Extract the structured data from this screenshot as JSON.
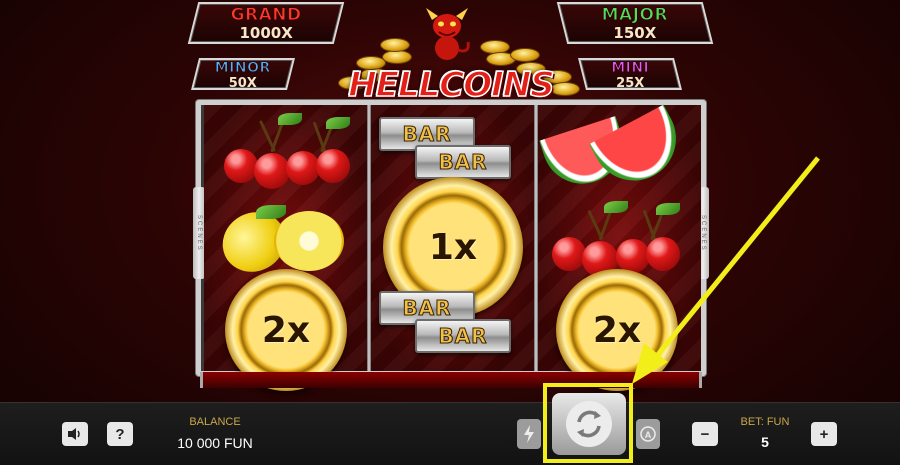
{
  "jackpots": {
    "grand": {
      "name": "GRAND",
      "multiplier": "1000X"
    },
    "major": {
      "name": "MAJOR",
      "multiplier": "150X"
    },
    "minor": {
      "name": "MINOR",
      "multiplier": "50X"
    },
    "mini": {
      "name": "MINI",
      "multiplier": "25X"
    }
  },
  "logo": "HELLCOINS",
  "reels": [
    {
      "symbols": [
        "cherries",
        "lemons",
        "coin"
      ],
      "coin_value": "2x"
    },
    {
      "symbols": [
        "bar-bar",
        "coin",
        "bar-bar"
      ],
      "coin_value": "1x",
      "bar_label": "BAR"
    },
    {
      "symbols": [
        "watermelon",
        "cherries",
        "coin"
      ],
      "coin_value": "2x"
    }
  ],
  "side_label": "SCENES",
  "controls": {
    "sound_icon": "speaker-icon",
    "help_label": "?",
    "balance_label": "BALANCE",
    "balance_value": "10 000 FUN",
    "turbo_icon": "lightning-icon",
    "spin_icon": "refresh-arrows-icon",
    "autoplay_icon": "autoplay-icon",
    "minus_label": "−",
    "plus_label": "+",
    "bet_label": "BET: FUN",
    "bet_value": "5"
  },
  "annotation": {
    "color": "#f2ee1a",
    "target": "spin-button"
  }
}
